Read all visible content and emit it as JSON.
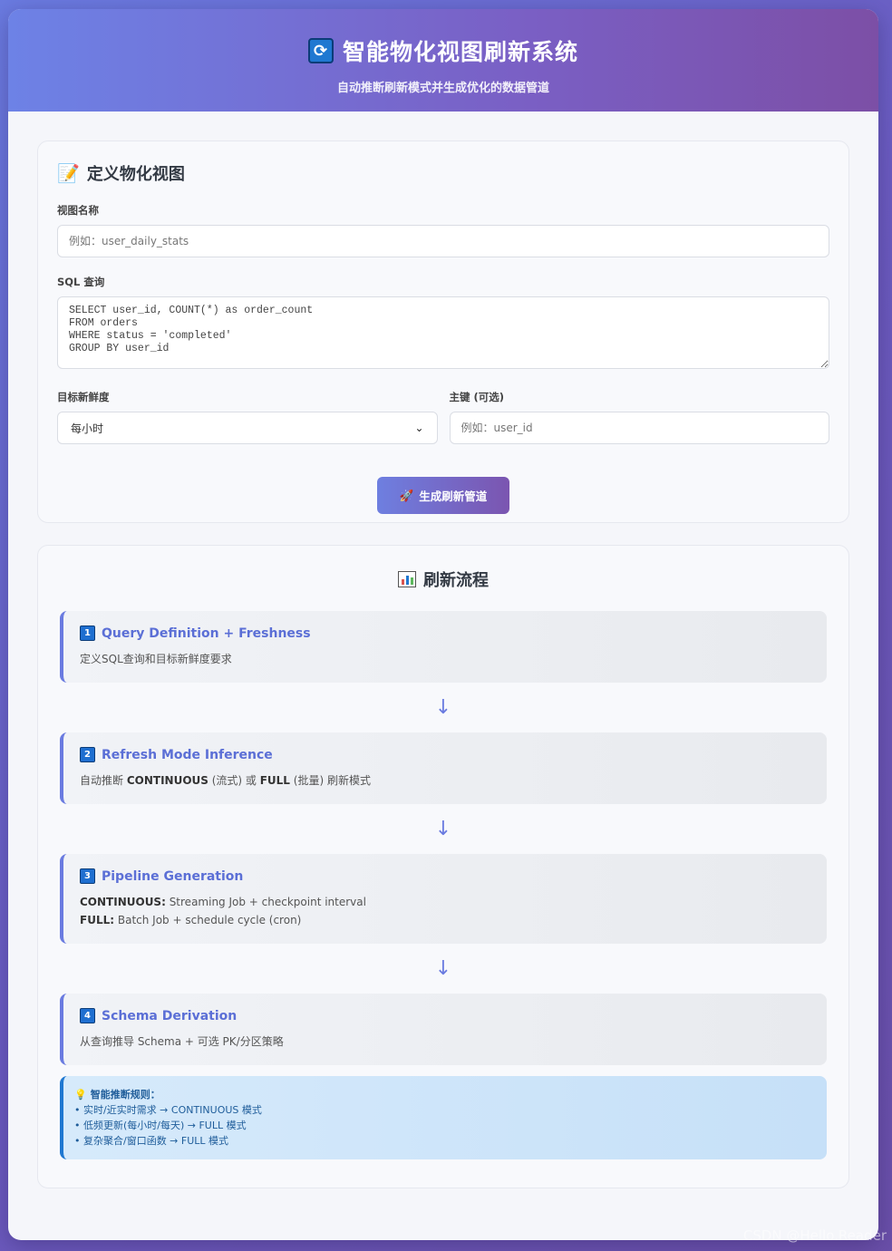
{
  "header": {
    "title": "智能物化视图刷新系统",
    "subtitle": "自动推断刷新模式并生成优化的数据管道",
    "icon": "refresh-icon"
  },
  "form": {
    "section_title": "定义物化视图",
    "view_name_label": "视图名称",
    "view_name_placeholder": "例如：user_daily_stats",
    "sql_label": "SQL 查询",
    "sql_value": "SELECT user_id, COUNT(*) as order_count\nFROM orders\nWHERE status = 'completed'\nGROUP BY user_id",
    "freshness_label": "目标新鲜度",
    "freshness_selected": "每小时",
    "pk_label": "主键 (可选)",
    "pk_placeholder": "例如：user_id",
    "generate_button": "生成刷新管道"
  },
  "flow": {
    "title": "刷新流程",
    "steps": [
      {
        "num": "1",
        "title": "Query Definition + Freshness",
        "desc": "定义SQL查询和目标新鲜度要求"
      },
      {
        "num": "2",
        "title": "Refresh Mode Inference",
        "desc_prefix": "自动推断 ",
        "desc_b1": "CONTINUOUS",
        "desc_mid": " (流式) 或 ",
        "desc_b2": "FULL",
        "desc_suffix": " (批量) 刷新模式"
      },
      {
        "num": "3",
        "title": "Pipeline Generation",
        "line1_b": "CONTINUOUS:",
        "line1": " Streaming Job + checkpoint interval",
        "line2_b": "FULL:",
        "line2": " Batch Job + schedule cycle (cron)"
      },
      {
        "num": "4",
        "title": "Schema Derivation",
        "desc": "从查询推导 Schema + 可选 PK/分区策略"
      }
    ],
    "arrow": "↓",
    "rules": {
      "title": "智能推断规则：",
      "items": [
        "• 实时/近实时需求 → CONTINUOUS 模式",
        "• 低频更新(每小时/每天) → FULL 模式",
        "• 复杂聚合/窗口函数 → FULL 模式"
      ]
    }
  },
  "watermark": "CSDN @Hello.Reader"
}
